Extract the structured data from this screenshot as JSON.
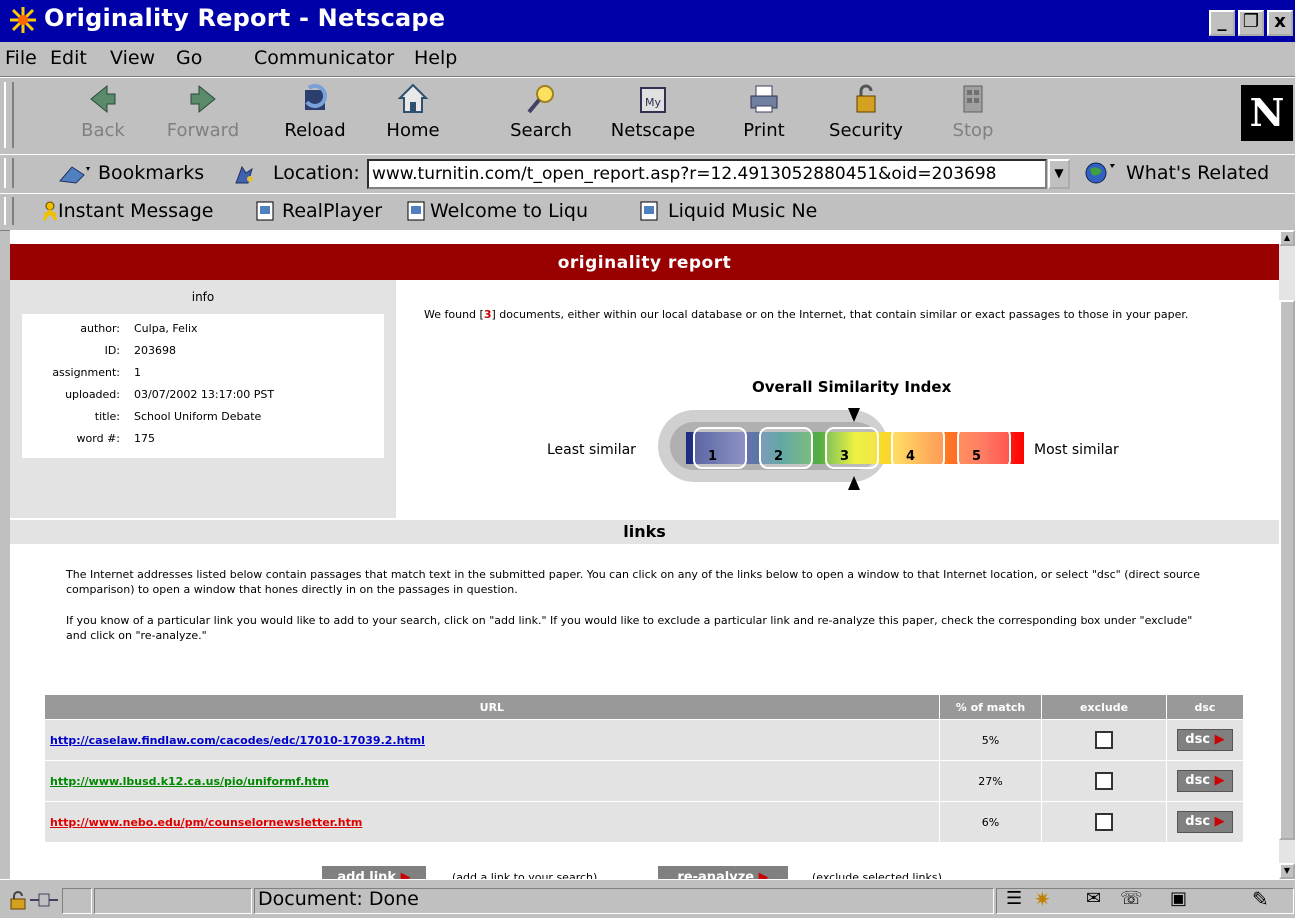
{
  "window": {
    "title": "Originality Report - Netscape",
    "min_label": "_",
    "max_label": "❐",
    "close_label": "x"
  },
  "menu": [
    "File",
    "Edit",
    "View",
    "Go",
    "Communicator",
    "Help"
  ],
  "nav_buttons": [
    {
      "label": "Back",
      "icon": "back-arrow-icon",
      "enabled": false
    },
    {
      "label": "Forward",
      "icon": "forward-arrow-icon",
      "enabled": false
    },
    {
      "label": "Reload",
      "icon": "reload-icon",
      "enabled": true
    },
    {
      "label": "Home",
      "icon": "home-icon",
      "enabled": true
    },
    {
      "label": "Search",
      "icon": "search-icon",
      "enabled": true
    },
    {
      "label": "Netscape",
      "icon": "my-netscape-icon",
      "enabled": true
    },
    {
      "label": "Print",
      "icon": "printer-icon",
      "enabled": true
    },
    {
      "label": "Security",
      "icon": "lock-icon",
      "enabled": true
    },
    {
      "label": "Stop",
      "icon": "stop-icon",
      "enabled": false
    }
  ],
  "logo_letter": "N",
  "location": {
    "bookmarks_label": "Bookmarks",
    "location_label": "Location:",
    "url": "www.turnitin.com/t_open_report.asp?r=12.4913052880451&oid=203698",
    "related_label": "What's Related"
  },
  "personal_bar": [
    "Instant Message",
    "RealPlayer",
    "Welcome to Liqu",
    "Liquid Music Ne"
  ],
  "report": {
    "header": "originality report",
    "info_heading": "info",
    "info": [
      {
        "key": "author:",
        "value": "Culpa, Felix"
      },
      {
        "key": "ID:",
        "value": "203698"
      },
      {
        "key": "assignment:",
        "value": "1"
      },
      {
        "key": "uploaded:",
        "value": "03/07/2002 13:17:00 PST"
      },
      {
        "key": "title:",
        "value": "School Uniform Debate"
      },
      {
        "key": "word #:",
        "value": "175"
      }
    ],
    "summary_pre": "We found [",
    "summary_count": "3",
    "summary_post": "] documents, either within our local database or on the Internet, that contain similar or exact passages to those in your paper.",
    "similarity": {
      "title": "Overall Similarity Index",
      "least_label": "Least similar",
      "most_label": "Most similar",
      "levels": [
        "1",
        "2",
        "3",
        "4",
        "5"
      ],
      "selected_level": 3
    },
    "links_heading": "links",
    "para1": "The Internet addresses listed below contain passages that match text in the submitted paper. You can click on any of the links below to open a window to that Internet location, or select \"dsc\" (direct source comparison) to open a window that hones directly in on the passages in question.",
    "para2": "If you know of a particular link you would like to add to your search, click on \"add link.\" If you would like to exclude a particular link and re-analyze this paper, check the corresponding box under \"exclude\" and click on \"re-analyze.\"",
    "table_headers": {
      "url": "URL",
      "pct": "% of match",
      "exclude": "exclude",
      "dsc": "dsc"
    },
    "rows": [
      {
        "url": "http://caselaw.findlaw.com/cacodes/edc/17010-17039.2.html",
        "pct": "5%",
        "color": "#0000cc",
        "excluded": false
      },
      {
        "url": "http://www.lbusd.k12.ca.us/pio/uniformf.htm",
        "pct": "27%",
        "color": "#008800",
        "excluded": false
      },
      {
        "url": "http://www.nebo.edu/pm/counselornewsletter.htm",
        "pct": "6%",
        "color": "#dd0000",
        "excluded": false
      }
    ],
    "dsc_label": "dsc",
    "add_link_label": "add link",
    "add_link_note": "(add a link to your search)",
    "reanalyze_label": "re-analyze",
    "reanalyze_note": "(exclude selected links)"
  },
  "status": {
    "text": "Document: Done"
  }
}
